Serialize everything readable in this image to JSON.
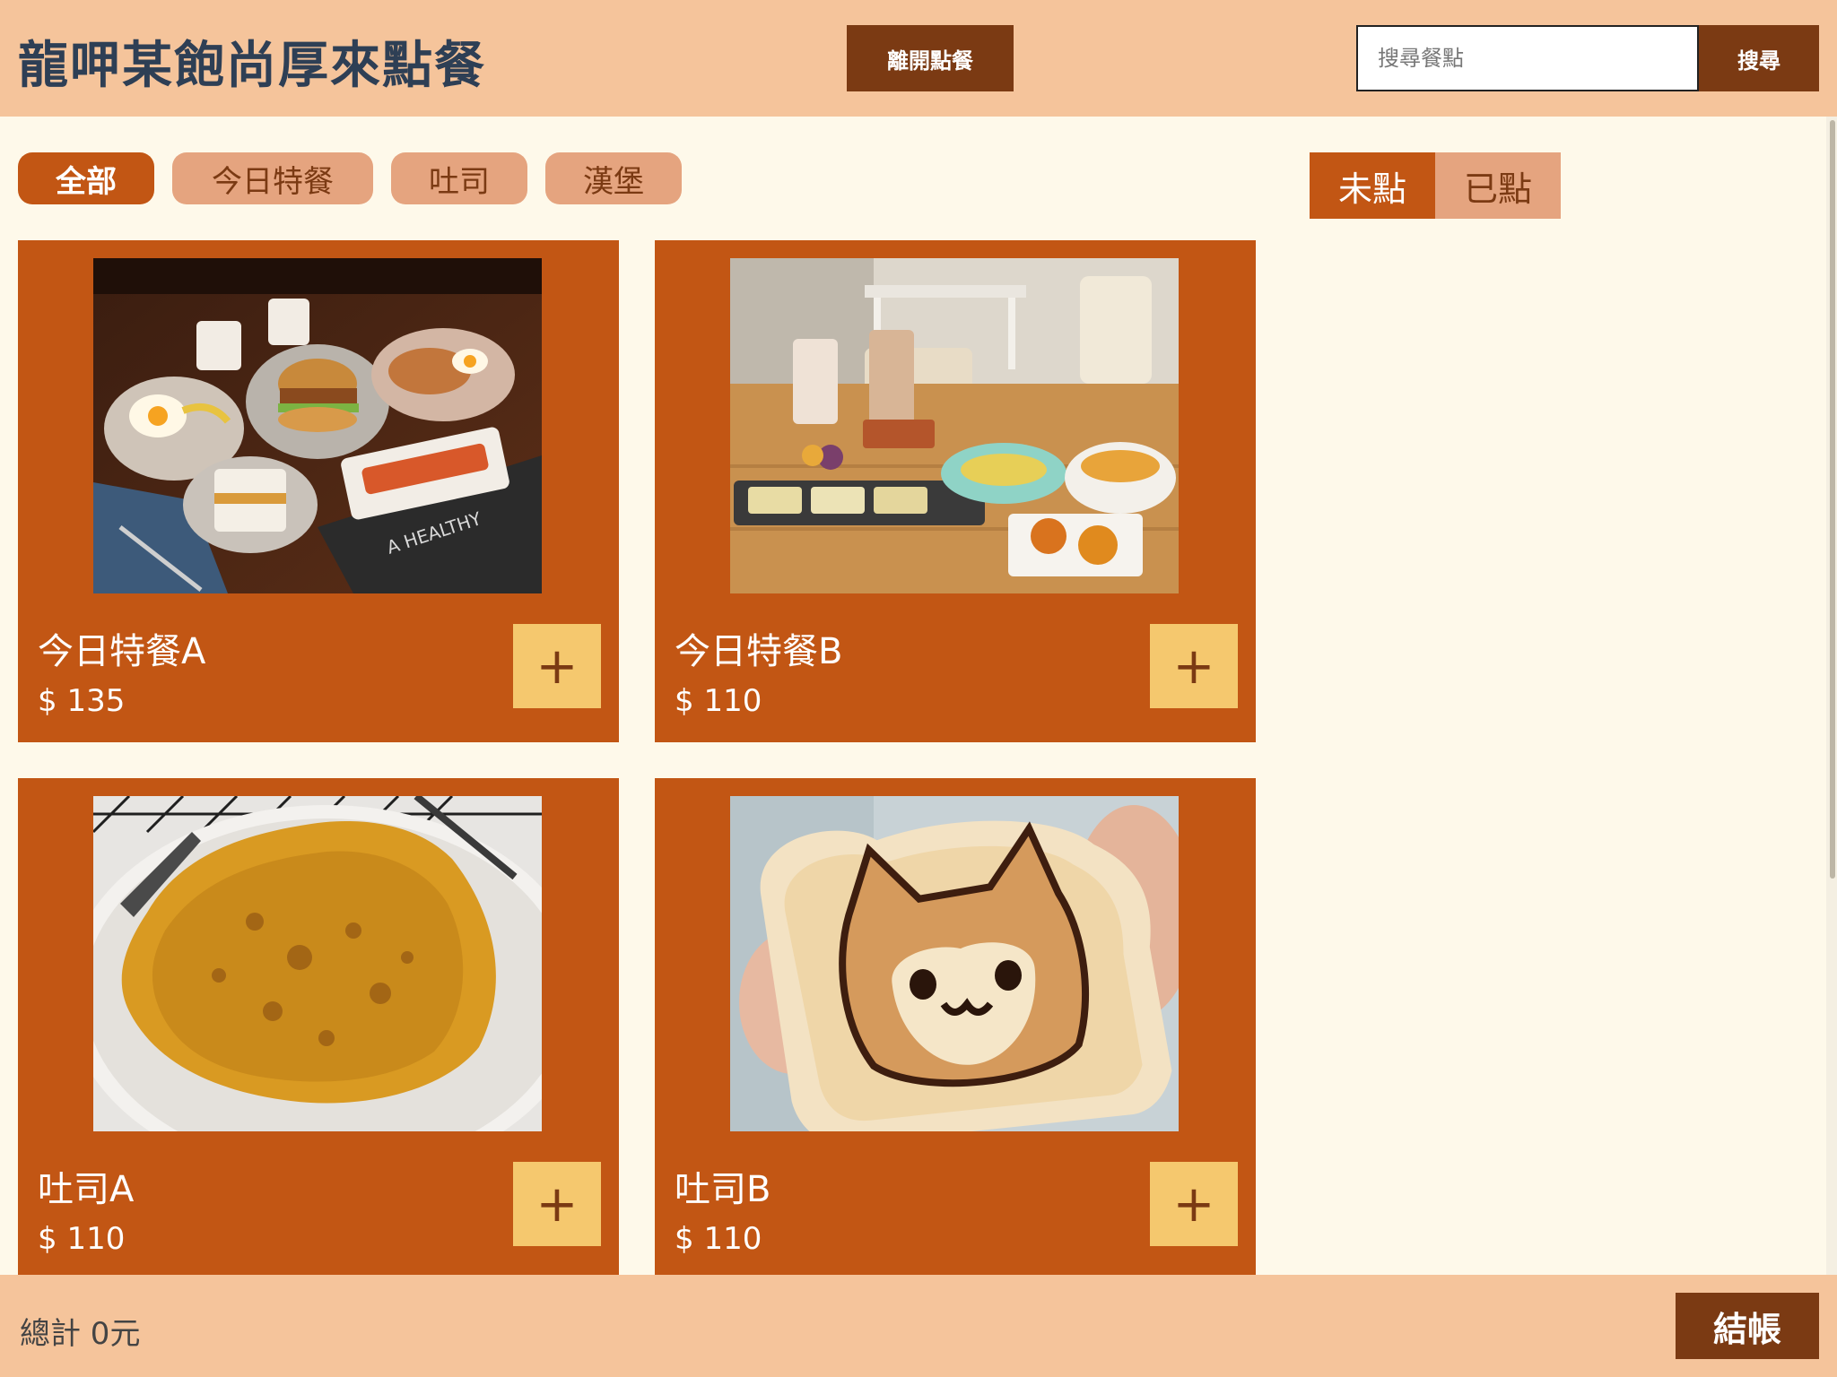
{
  "header": {
    "title": "龍呷某飽尚厚來點餐",
    "leave_label": "離開點餐",
    "search_placeholder": "搜尋餐點",
    "search_value": "",
    "search_label": "搜尋"
  },
  "categories": [
    {
      "label": "全部",
      "active": true
    },
    {
      "label": "今日特餐",
      "active": false
    },
    {
      "label": "吐司",
      "active": false
    },
    {
      "label": "漢堡",
      "active": false
    }
  ],
  "order_tabs": [
    {
      "label": "未點",
      "active": true
    },
    {
      "label": "已點",
      "active": false
    }
  ],
  "items": [
    {
      "name": "今日特餐A",
      "price": "$ 135",
      "image": "breakfast-spread-photo",
      "add_label": "+"
    },
    {
      "name": "今日特餐B",
      "price": "$ 110",
      "image": "cafe-table-breakfast-photo",
      "add_label": "+"
    },
    {
      "name": "吐司A",
      "price": "$ 110",
      "image": "french-toast-photo",
      "add_label": "+"
    },
    {
      "name": "吐司B",
      "price": "$ 110",
      "image": "shiba-toast-photo",
      "add_label": "+"
    }
  ],
  "footer": {
    "total": "總計 0元",
    "checkout_label": "結帳"
  },
  "colors": {
    "header_bg": "#f5c49b",
    "page_bg": "#fef9ea",
    "accent": "#c25614",
    "dark_brown": "#7b3a13",
    "pill_inactive": "#e5a47f",
    "add_button": "#f5c86e",
    "title": "#2e3f55"
  }
}
